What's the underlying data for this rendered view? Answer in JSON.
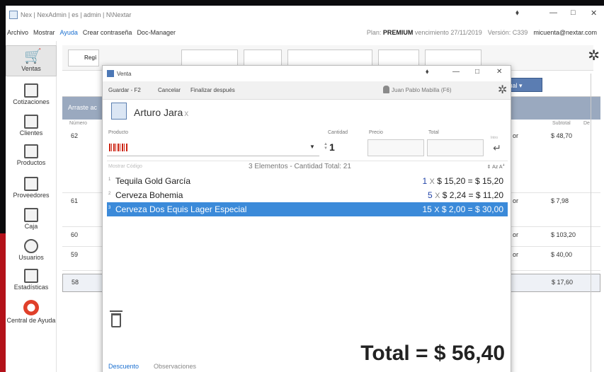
{
  "window": {
    "title": "Nex | NexAdmin | es | admin | N\\Nextar",
    "pin": "⬧",
    "minimize": "—",
    "maximize": "□",
    "close": "✕"
  },
  "menu": {
    "items": [
      "Archivo",
      "Mostrar",
      "Ayuda",
      "Crear contraseña",
      "Doc-Manager"
    ],
    "plan_prefix": "Plan:",
    "plan_name": "PREMIUM",
    "plan_suffix": "vencimiento 27/11/2019",
    "version": "Versión: C339",
    "account": "micuenta@nextar.com"
  },
  "sidebar": {
    "items": [
      {
        "label": "Ventas",
        "icon": "cart-icon"
      },
      {
        "label": "Cotizaciones",
        "icon": "document-icon"
      },
      {
        "label": "Clientes",
        "icon": "clients-icon"
      },
      {
        "label": "Productos",
        "icon": "products-icon"
      },
      {
        "label": "Proveedores",
        "icon": "truck-icon"
      },
      {
        "label": "Caja",
        "icon": "register-icon"
      },
      {
        "label": "Usuarios",
        "icon": "user-icon"
      },
      {
        "label": "Estadísticas",
        "icon": "chart-icon"
      },
      {
        "label": "Central de Ayuda",
        "icon": "lifebuoy-icon"
      }
    ]
  },
  "main": {
    "toolbar_first": "Regi",
    "grid_header_text": "Arraste ac",
    "ventas_dropdown": "Ventas de caja actual ▾",
    "col_number": "Número",
    "col_subtotal": "Subtotal",
    "col_d": "De",
    "rows": [
      {
        "num": "62",
        "or": "or",
        "sub": "$ 48,70"
      },
      {
        "num": "61",
        "or": "or",
        "sub": "$ 7,98"
      },
      {
        "num": "60",
        "or": "or",
        "sub": "$ 103,20"
      },
      {
        "num": "59",
        "or": "or",
        "sub": "$ 40,00"
      },
      {
        "num": "58",
        "or": "",
        "sub": "$ 17,60"
      }
    ]
  },
  "dialog": {
    "title": "Venta",
    "pin": "⬧",
    "minimize": "—",
    "maximize": "□",
    "close": "✕",
    "btn_save": "Guardar - F2",
    "btn_cancel": "Cancelar",
    "btn_finish_later": "Finalizar después",
    "user": "Juan Pablo Mabilla (F6)",
    "customer": "Arturo Jara",
    "customer_remove": "x",
    "label_product": "Producto",
    "label_quantity": "Cantidad",
    "label_price": "Precio",
    "label_total": "Total",
    "quantity_value": "1",
    "enter_label": "Intro",
    "list_hint": "Mostrar Código",
    "list_summary": "3 Elementos - Cantidad Total: 21",
    "sort_label": "⇕ Az Aꜜ",
    "items": [
      {
        "idx": "1",
        "name": "Tequila Gold García",
        "qty": "1",
        "x": "X",
        "price": "$ 15,20",
        "eq": "=",
        "total": "$ 15,20"
      },
      {
        "idx": "2",
        "name": "Cerveza Bohemia",
        "qty": "5",
        "x": "X",
        "price": "$ 2,24",
        "eq": "=",
        "total": "$ 11,20"
      },
      {
        "idx": "3",
        "name": "Cerveza Dos Equis Lager Especial",
        "qty": "15",
        "x": "X",
        "price": "$ 2,00",
        "eq": "=",
        "total": "$ 30,00"
      }
    ],
    "grand_total": "Total = $ 56,40",
    "footer_discount": "Descuento",
    "footer_notes": "Observaciones"
  },
  "colors": {
    "accent": "#1a6fd0",
    "selection": "#3b8ad9",
    "brand_red": "#b3121a"
  }
}
